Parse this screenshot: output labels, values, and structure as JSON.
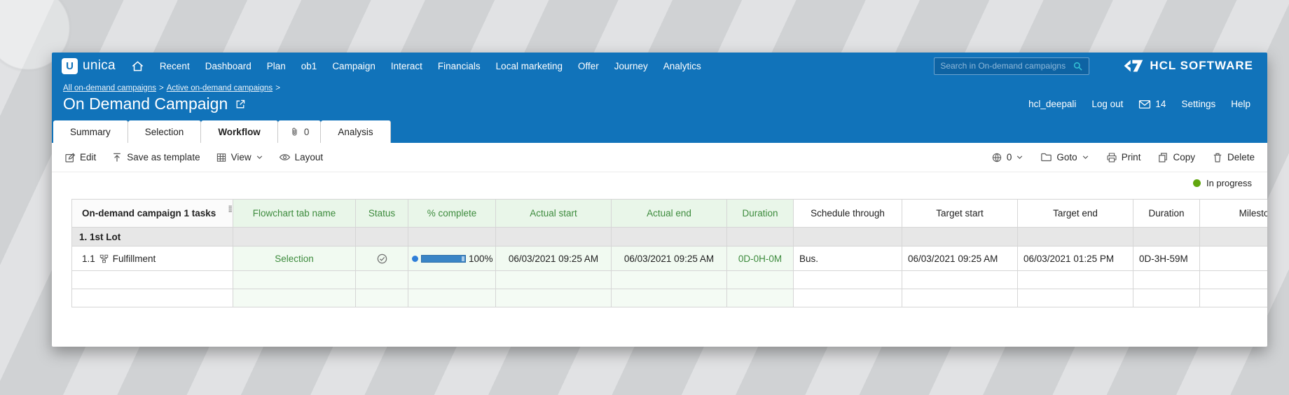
{
  "colors": {
    "nav_blue": "#1173ba",
    "green_text": "#3d8b3d",
    "green_bg": "#e9f6e9",
    "progress_blue": "#3a85c6",
    "in_progress_dot": "#61a60e",
    "search_icon_teal": "#35c4d7"
  },
  "nav": {
    "brand": "unica",
    "items": [
      "Recent",
      "Dashboard",
      "Plan",
      "ob1",
      "Campaign",
      "Interact",
      "Financials",
      "Local marketing",
      "Offer",
      "Journey",
      "Analytics"
    ],
    "search_placeholder": "Search in On-demand campaigns",
    "logo": "HCL SOFTWARE"
  },
  "header": {
    "breadcrumb": [
      "All on-demand campaigns",
      "Active on-demand campaigns"
    ],
    "separator": ">",
    "title": "On Demand Campaign",
    "user": "hcl_deepali",
    "logout": "Log out",
    "mail_count": "14",
    "settings": "Settings",
    "help": "Help"
  },
  "tabs": {
    "summary": "Summary",
    "selection": "Selection",
    "workflow": "Workflow",
    "attachments": "0",
    "analysis": "Analysis"
  },
  "toolbar": {
    "edit": "Edit",
    "save_as_template": "Save as template",
    "view": "View",
    "layout": "Layout",
    "link_count": "0",
    "goto": "Goto",
    "print": "Print",
    "copy": "Copy",
    "delete": "Delete"
  },
  "legend": {
    "in_progress": "In progress"
  },
  "table": {
    "task_col_header": "On-demand campaign 1 tasks",
    "headers": {
      "flowchart": "Flowchart tab name",
      "status": "Status",
      "pct": "% complete",
      "actual_start": "Actual start",
      "actual_end": "Actual end",
      "duration": "Duration",
      "schedule": "Schedule through",
      "target_start": "Target start",
      "target_end": "Target end",
      "target_duration": "Duration",
      "milestone": "Milestone"
    },
    "group_row": {
      "label": "1. 1st Lot"
    },
    "row": {
      "index": "1.1",
      "name": "Fulfillment",
      "flowchart": "Selection",
      "pct": "100%",
      "actual_start": "06/03/2021 09:25 AM",
      "actual_end": "06/03/2021 09:25 AM",
      "duration": "0D-0H-0M",
      "schedule": "Bus.",
      "target_start": "06/03/2021 09:25 AM",
      "target_end": "06/03/2021 01:25 PM",
      "target_duration": "0D-3H-59M",
      "milestone": ""
    }
  }
}
